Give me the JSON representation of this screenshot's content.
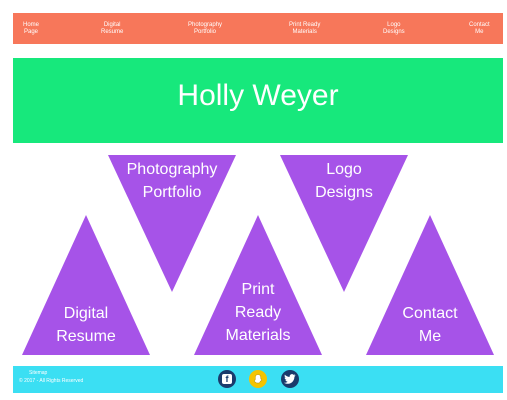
{
  "nav": {
    "items": [
      {
        "label_line1": "Home",
        "label_line2": "Page"
      },
      {
        "label_line1": "Digital",
        "label_line2": "Resume"
      },
      {
        "label_line1": "Photography",
        "label_line2": "Portfolio"
      },
      {
        "label_line1": "Print Ready",
        "label_line2": "Materials"
      },
      {
        "label_line1": "Logo",
        "label_line2": "Designs"
      },
      {
        "label_line1": "Contact",
        "label_line2": "Me"
      }
    ]
  },
  "banner": {
    "title": "Holly Weyer"
  },
  "tiles": {
    "photography": {
      "line1": "Photography",
      "line2": "Portfolio"
    },
    "logo": {
      "line1": "Logo",
      "line2": "Designs"
    },
    "resume": {
      "line1": "Digital",
      "line2": "Resume"
    },
    "print": {
      "line1": "Print",
      "line2": "Ready",
      "line3": "Materials"
    },
    "contact": {
      "line1": "Contact",
      "line2": "Me"
    }
  },
  "footer": {
    "sitemap": "Sitemap",
    "copyright": "© 2017 - All Rights Reserved"
  },
  "colors": {
    "nav_bg": "#f7775a",
    "banner_bg": "#17e87c",
    "tile_purple": "#a653e8",
    "footer_bg": "#3bdff3"
  },
  "social": {
    "facebook_icon": "facebook-icon",
    "snapchat_icon": "snapchat-icon",
    "twitter_icon": "twitter-icon"
  }
}
